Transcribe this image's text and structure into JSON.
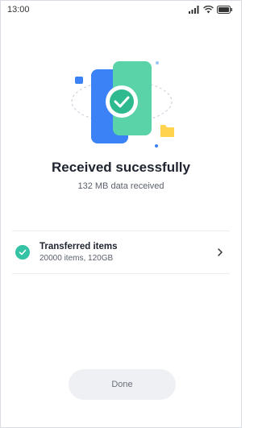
{
  "status_bar": {
    "time": "13:00",
    "icons": [
      "signal-icon",
      "wifi-icon",
      "battery-icon"
    ]
  },
  "illustration": {
    "icon": "phones-transfer-check-illustration",
    "colors": {
      "phone_back": "#3b82f6",
      "phone_front": "#59d3a7",
      "check_badge": "#ffffff",
      "check_mark": "#2fb98f",
      "accent_blue": "#3b82f6",
      "accent_yellow": "#ffd34d"
    }
  },
  "result": {
    "title": "Received sucessfully",
    "subtitle": "132 MB data received"
  },
  "transferred": {
    "title": "Transferred items",
    "detail": "20000 items, 120GB",
    "icon": "check-circle-icon",
    "chevron": "chevron-right-icon"
  },
  "actions": {
    "done_label": "Done"
  },
  "colors": {
    "accent": "#34c3a4",
    "button_bg": "#eef0f3",
    "text_primary": "#1f2430",
    "text_secondary": "#5b606b"
  }
}
